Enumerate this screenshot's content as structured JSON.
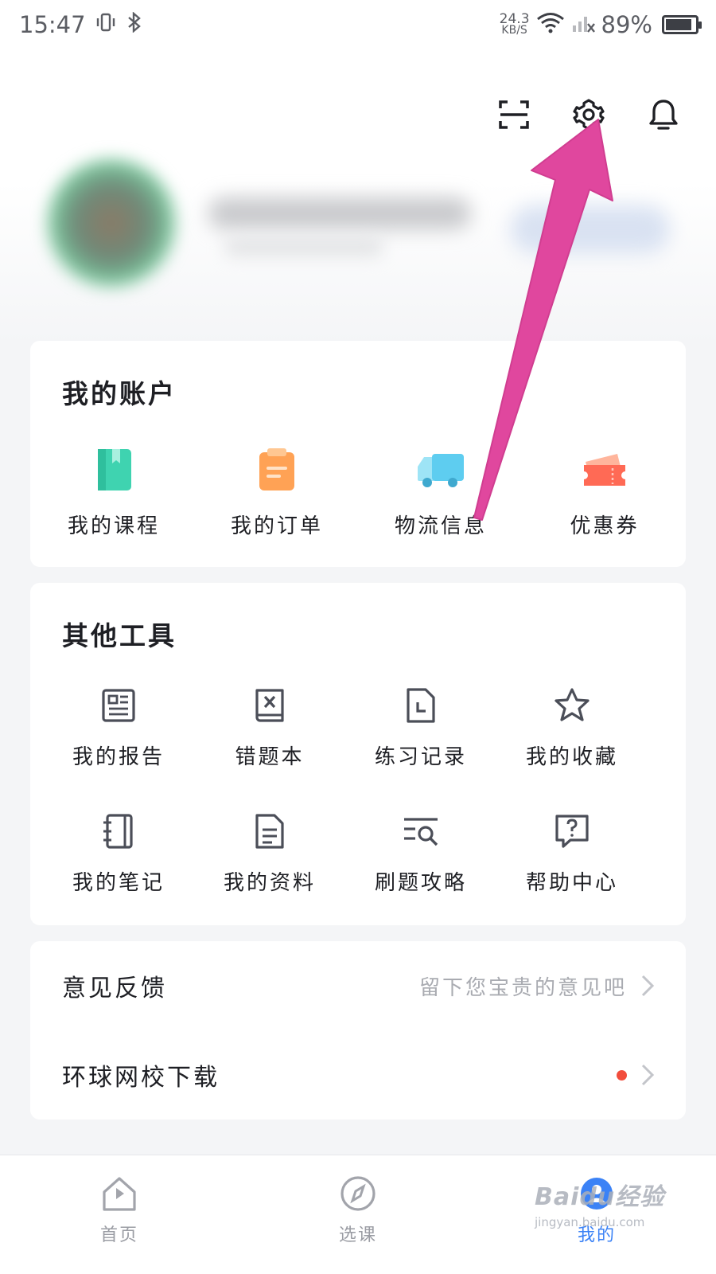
{
  "status_bar": {
    "time": "15:47",
    "net_speed_value": "24.3",
    "net_speed_unit": "KB/S",
    "battery": "89%"
  },
  "account": {
    "title": "我的账户",
    "items": [
      {
        "label": "我的课程",
        "icon": "course-book-icon",
        "color": "#3fd3b0"
      },
      {
        "label": "我的订单",
        "icon": "order-clipboard-icon",
        "color": "#ffa255"
      },
      {
        "label": "物流信息",
        "icon": "delivery-truck-icon",
        "color": "#5ecdf0"
      },
      {
        "label": "优惠券",
        "icon": "coupon-ticket-icon",
        "color": "#ff6a55"
      }
    ]
  },
  "tools": {
    "title": "其他工具",
    "items": [
      {
        "label": "我的报告",
        "icon": "report-icon"
      },
      {
        "label": "错题本",
        "icon": "wrong-questions-book-icon"
      },
      {
        "label": "练习记录",
        "icon": "practice-record-icon"
      },
      {
        "label": "我的收藏",
        "icon": "star-icon"
      },
      {
        "label": "我的笔记",
        "icon": "notebook-icon"
      },
      {
        "label": "我的资料",
        "icon": "document-icon"
      },
      {
        "label": "刷题攻略",
        "icon": "search-list-icon"
      },
      {
        "label": "帮助中心",
        "icon": "help-icon"
      }
    ]
  },
  "list": {
    "feedback": {
      "title": "意见反馈",
      "hint": "留下您宝贵的意见吧"
    },
    "download": {
      "title": "环球网校下载"
    }
  },
  "bottom_nav": {
    "items": [
      {
        "label": "首页",
        "icon": "home-icon"
      },
      {
        "label": "选课",
        "icon": "compass-icon"
      },
      {
        "label": "我的",
        "icon": "profile-icon",
        "active": true
      }
    ]
  },
  "watermark": {
    "brand": "Baidu经验",
    "url": "jingyan.baidu.com"
  },
  "colors": {
    "accent": "#3b82f6",
    "annotation_arrow": "#e0479e",
    "badge_red": "#f24d3c"
  }
}
